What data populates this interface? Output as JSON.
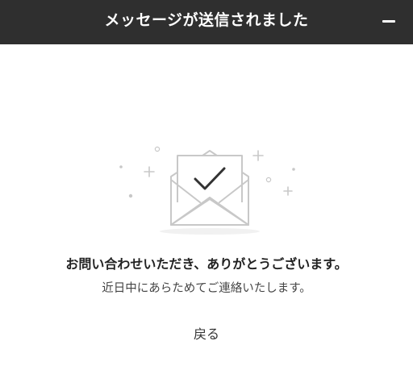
{
  "header": {
    "title": "メッセージが送信されました",
    "background": "#2f2f2f"
  },
  "controls": {
    "minimize_icon": "minimize-icon"
  },
  "illustration": {
    "icon": "envelope-check-icon",
    "line_color": "#c8c8c8",
    "check_color": "#333333"
  },
  "message": {
    "main": "お問い合わせいただき、ありがとうございます。",
    "sub": "近日中にあらためてご連絡いたします。"
  },
  "actions": {
    "back_label": "戻る"
  }
}
